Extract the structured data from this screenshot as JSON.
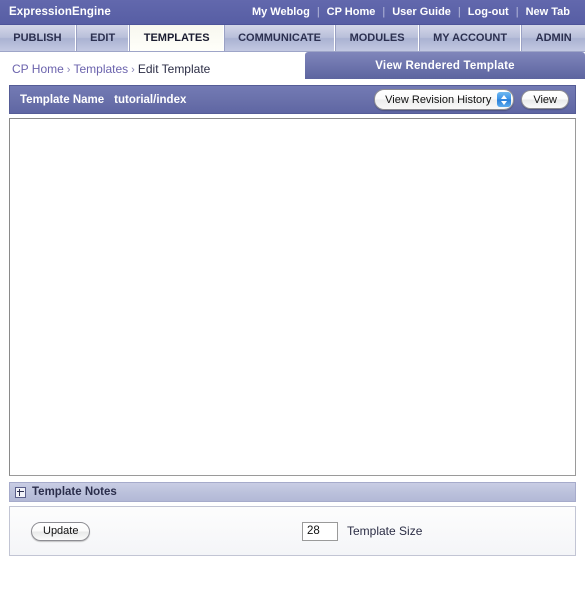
{
  "brand": {
    "title": "ExpressionEngine",
    "links": [
      {
        "label": "My Weblog"
      },
      {
        "label": "CP Home"
      },
      {
        "label": "User Guide"
      },
      {
        "label": "Log-out"
      },
      {
        "label": "New Tab"
      }
    ],
    "separator": "|"
  },
  "nav": {
    "tabs": [
      {
        "label": "PUBLISH",
        "active": false
      },
      {
        "label": "EDIT",
        "active": false
      },
      {
        "label": "TEMPLATES",
        "active": true
      },
      {
        "label": "COMMUNICATE",
        "active": false
      },
      {
        "label": "MODULES",
        "active": false
      },
      {
        "label": "MY ACCOUNT",
        "active": false
      },
      {
        "label": "ADMIN",
        "active": false
      }
    ]
  },
  "breadcrumb": {
    "home": "CP Home",
    "section": "Templates",
    "current": "Edit Template",
    "separator": "›"
  },
  "render_tab": {
    "label": "View Rendered Template"
  },
  "template_header": {
    "name_label": "Template Name",
    "name_value": "tutorial/index",
    "revision_select": "View Revision History",
    "view_button": "View"
  },
  "editor": {
    "content": ""
  },
  "notes": {
    "label": "Template Notes",
    "expand_icon": "plus-icon"
  },
  "footer": {
    "update_button": "Update",
    "size_value": "28",
    "size_label": "Template Size"
  },
  "colors": {
    "brand_bar": "#5b62a8",
    "nav_bar": "#b9bfda",
    "accent": "#6b63ad",
    "active_tab": "#fdfdf7",
    "header_bar": "#6a71ab",
    "aqua_blue": "#3c93e8"
  }
}
